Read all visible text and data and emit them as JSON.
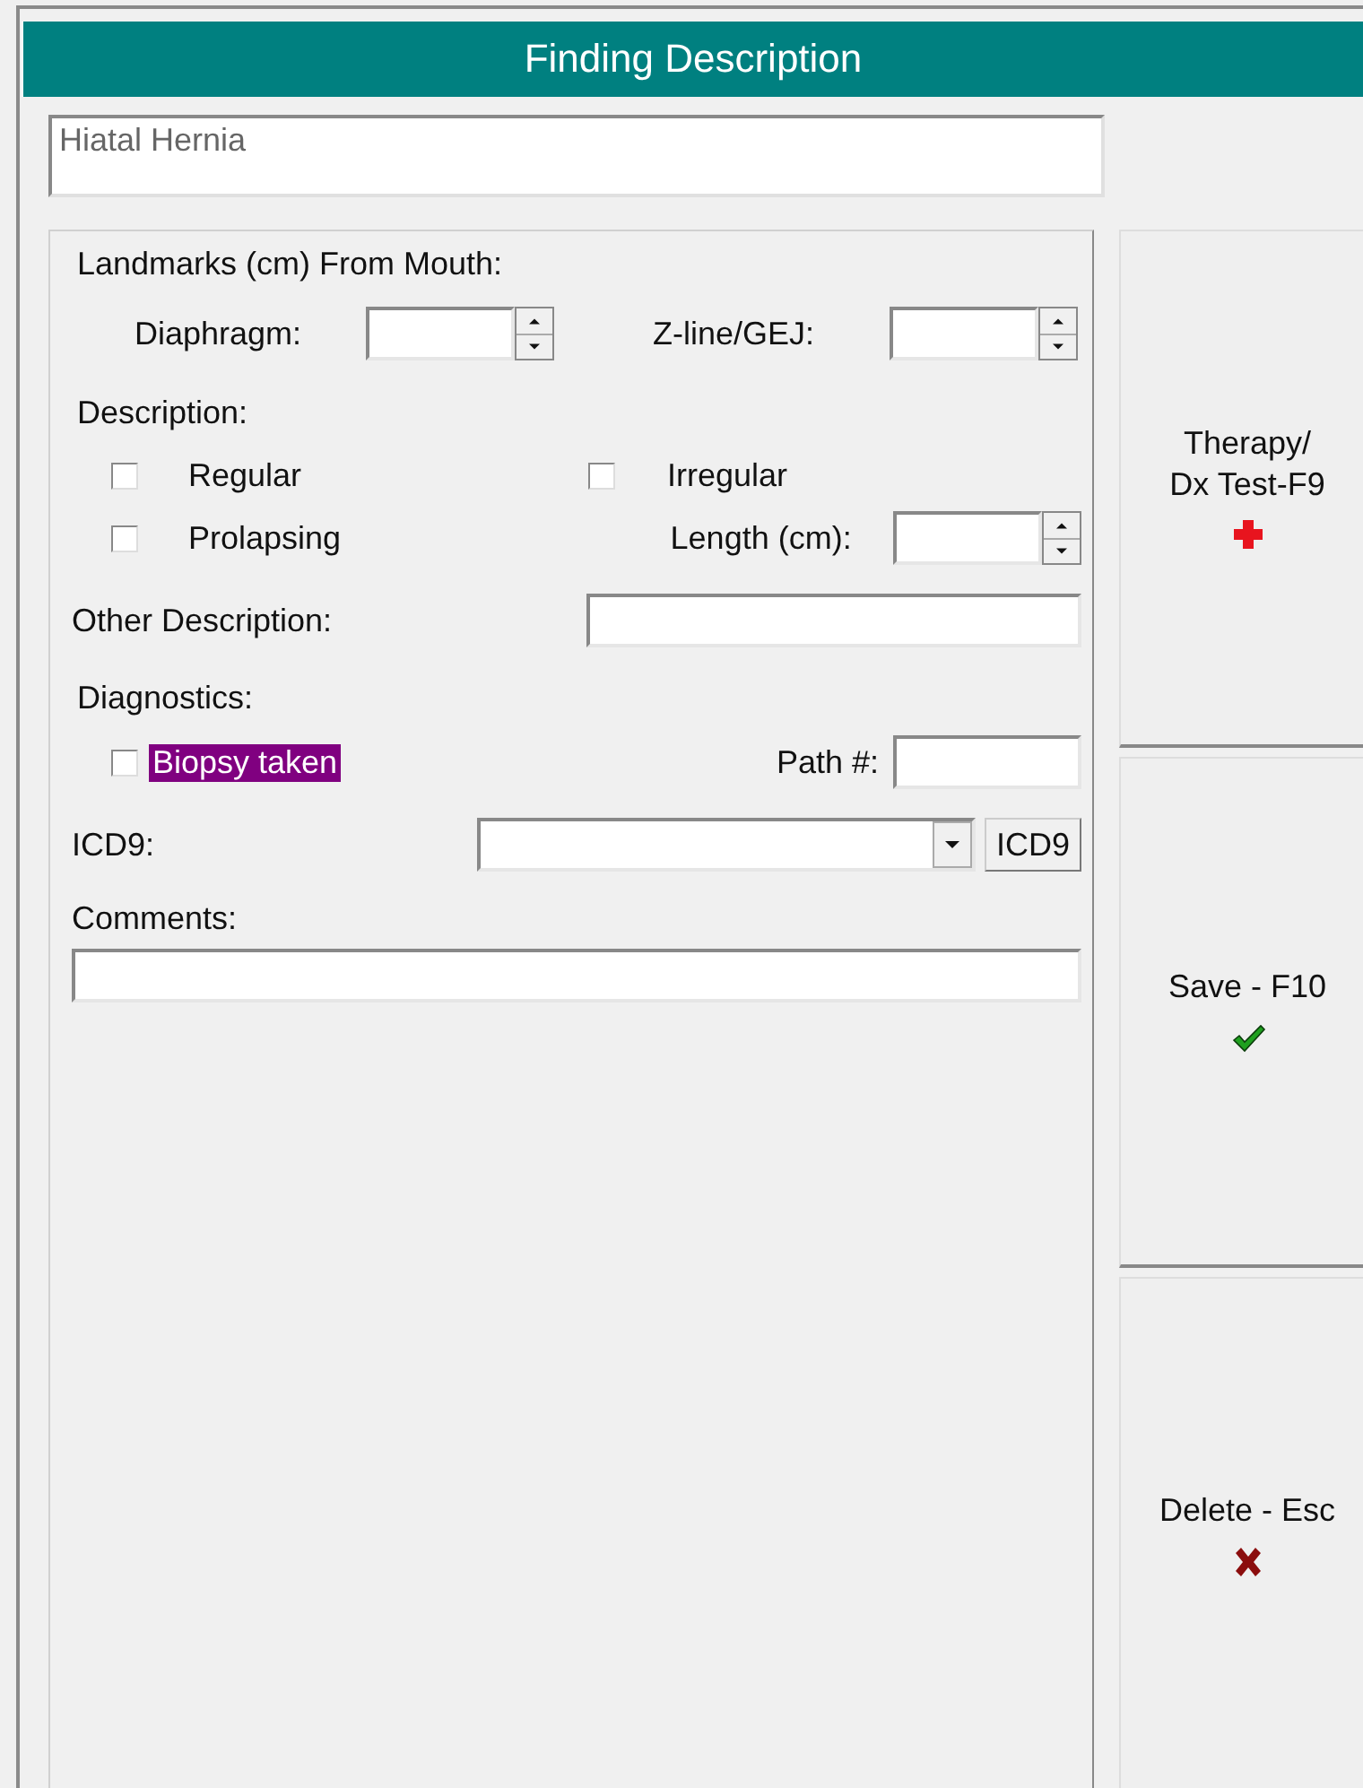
{
  "window": {
    "title": "Finding Description"
  },
  "finding_name": {
    "value": "Hiatal Hernia"
  },
  "landmarks": {
    "label": "Landmarks (cm) From Mouth:",
    "fields": [
      {
        "label": "Diaphragm:"
      },
      {
        "label": "Z-line/GEJ:"
      }
    ]
  },
  "description": {
    "label": "Description:",
    "options": [
      {
        "label": "Regular",
        "checked": false
      },
      {
        "label": "Irregular",
        "checked": false
      },
      {
        "label": "Prolapsing",
        "checked": false
      }
    ],
    "length_label": "Length (cm):"
  },
  "other_description": {
    "label": "Other Description:"
  },
  "diagnostics": {
    "label": "Diagnostics:",
    "biopsy": {
      "label": "Biopsy taken",
      "checked": false,
      "highlighted": true
    },
    "path_label": "Path #:"
  },
  "icd9": {
    "label": "ICD9:",
    "button": "ICD9"
  },
  "comments": {
    "label": "Comments:"
  },
  "buttons": [
    {
      "label": "Therapy/\nDx Test-F9",
      "kind": "therapy"
    },
    {
      "label": "Save - F10",
      "kind": "save"
    },
    {
      "label": "Delete - Esc",
      "kind": "delete"
    }
  ]
}
